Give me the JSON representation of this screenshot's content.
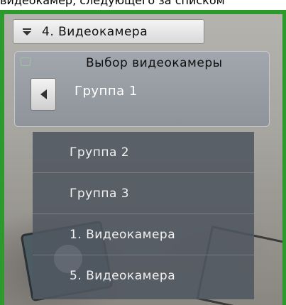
{
  "caption": "видеокамер, следующего за списком",
  "selector": {
    "label": "4. Видеокамера",
    "icon": "filter-dropdown-icon"
  },
  "panel": {
    "title": "Выбор видеокамеры",
    "current_group": "Группа 1",
    "back_icon": "chevron-left-icon"
  },
  "menu": {
    "items": [
      {
        "label": "Группа 2"
      },
      {
        "label": "Группа 3"
      },
      {
        "label": "1. Видеокамера"
      },
      {
        "label": "5. Видеокамера"
      }
    ]
  },
  "colors": {
    "frame": "#2c9a2c",
    "menu_bg": "#505660",
    "panel_bg": "#979ba2"
  }
}
